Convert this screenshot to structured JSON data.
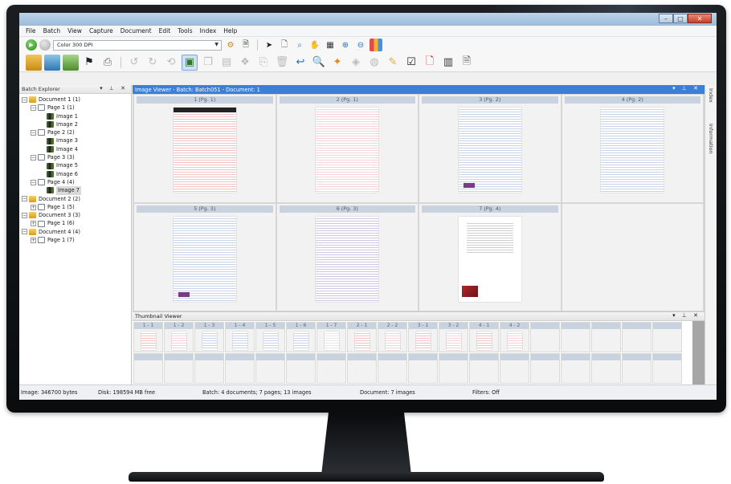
{
  "menu": [
    "File",
    "Batch",
    "View",
    "Capture",
    "Document",
    "Edit",
    "Tools",
    "Index",
    "Help"
  ],
  "toolbar": {
    "scan_profile": "Color 300 DPI"
  },
  "batch_explorer": {
    "title": "Batch Explorer",
    "tree": [
      {
        "label": "Document 1 (1)",
        "level": 0,
        "type": "folder",
        "exp": "−"
      },
      {
        "label": "Page 1 (1)",
        "level": 1,
        "type": "page",
        "exp": "−"
      },
      {
        "label": "Image 1",
        "level": 2,
        "type": "image"
      },
      {
        "label": "Image 2",
        "level": 2,
        "type": "image"
      },
      {
        "label": "Page 2 (2)",
        "level": 1,
        "type": "page",
        "exp": "−"
      },
      {
        "label": "Image 3",
        "level": 2,
        "type": "image"
      },
      {
        "label": "Image 4",
        "level": 2,
        "type": "image"
      },
      {
        "label": "Page 3 (3)",
        "level": 1,
        "type": "page",
        "exp": "−"
      },
      {
        "label": "Image 5",
        "level": 2,
        "type": "image"
      },
      {
        "label": "Image 6",
        "level": 2,
        "type": "image"
      },
      {
        "label": "Page 4 (4)",
        "level": 1,
        "type": "page",
        "exp": "−"
      },
      {
        "label": "Image 7",
        "level": 2,
        "type": "image",
        "selected": true
      },
      {
        "label": "Document 2 (2)",
        "level": 0,
        "type": "folder",
        "exp": "−"
      },
      {
        "label": "Page 1 (5)",
        "level": 1,
        "type": "page",
        "exp": "+"
      },
      {
        "label": "Document 3 (3)",
        "level": 0,
        "type": "folder",
        "exp": "−"
      },
      {
        "label": "Page 1 (6)",
        "level": 1,
        "type": "page",
        "exp": "+"
      },
      {
        "label": "Document 4 (4)",
        "level": 0,
        "type": "folder",
        "exp": "−"
      },
      {
        "label": "Page 1 (7)",
        "level": 1,
        "type": "page",
        "exp": "+"
      }
    ]
  },
  "image_viewer": {
    "title": "Image Viewer - Batch: Batch051 - Document: 1",
    "cells": [
      {
        "label": "1 (Pg. 1)",
        "style": "red"
      },
      {
        "label": "2 (Pg. 1)",
        "style": "pink"
      },
      {
        "label": "3 (Pg. 2)",
        "style": "blue"
      },
      {
        "label": "4 (Pg. 2)",
        "style": "blue"
      },
      {
        "label": "5 (Pg. 3)",
        "style": "blue"
      },
      {
        "label": "6 (Pg. 3)",
        "style": "purple"
      },
      {
        "label": "7 (Pg. 4)",
        "style": "photo"
      },
      {
        "label": "",
        "style": "empty"
      }
    ]
  },
  "right_rail": [
    "Index",
    "Information"
  ],
  "thumbnail_viewer": {
    "title": "Thumbnail Viewer",
    "thumbs": [
      "1 - 1",
      "1 - 2",
      "1 - 3",
      "1 - 4",
      "1 - 5",
      "1 - 6",
      "1 - 7",
      "2 - 1",
      "2 - 2",
      "3 - 1",
      "3 - 2",
      "4 - 1",
      "4 - 2"
    ]
  },
  "status": {
    "image": "Image: 346700 bytes",
    "disk": "Disk: 198594 MB free",
    "batch": "Batch: 4 documents; 7 pages; 13 images",
    "document": "Document: 7 images",
    "filters": "Filters: Off"
  },
  "colors": {
    "viewer_header": "#3b7fd6",
    "cell_label_bg": "#c9d3df",
    "titlebar": "#9cbad8"
  }
}
